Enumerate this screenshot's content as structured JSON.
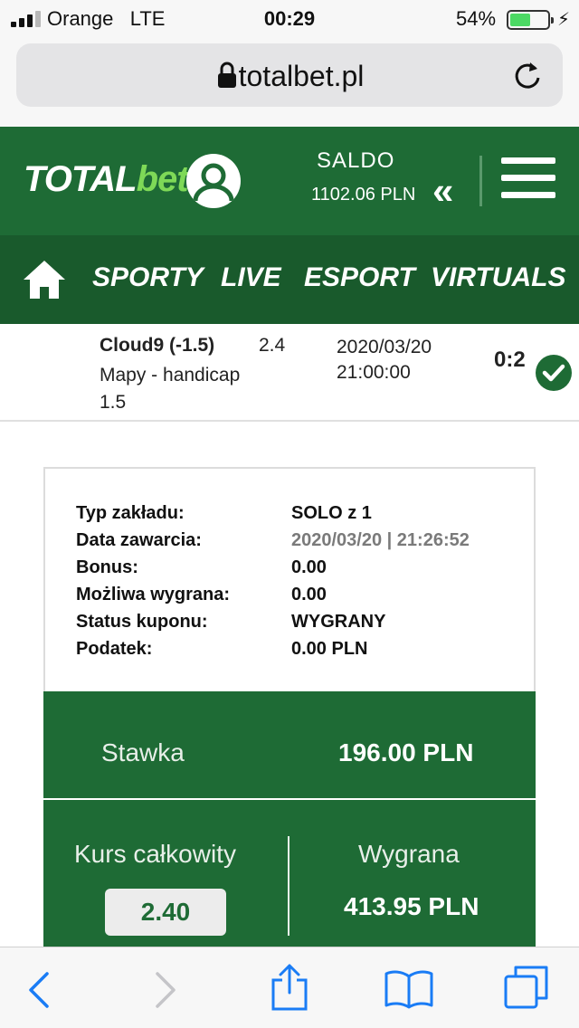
{
  "status_bar": {
    "carrier": "Orange",
    "network": "LTE",
    "time": "00:29",
    "battery_percent": "54%",
    "battery_level": 0.54
  },
  "browser": {
    "url": "totalbet.pl"
  },
  "header": {
    "logo_total": "TOTAL",
    "logo_bet": "bet",
    "saldo_label": "SALDO",
    "saldo_value": "1102.06 PLN"
  },
  "nav": {
    "items": [
      "SPORTY",
      "LIVE",
      "ESPORT",
      "VIRTUALS"
    ]
  },
  "bet": {
    "selection": "Cloud9 (-1.5)",
    "market": "Mapy - handicap 1.5",
    "odd": "2.4",
    "date": "2020/03/20",
    "time": "21:00:00",
    "score": "0:2"
  },
  "summary": {
    "rows": [
      {
        "label": "Typ zakładu:",
        "value": "SOLO z 1"
      },
      {
        "label": "Data zawarcia:",
        "value": "2020/03/20 | 21:26:52"
      },
      {
        "label": "Bonus:",
        "value": "0.00"
      },
      {
        "label": "Możliwa wygrana:",
        "value": "0.00"
      },
      {
        "label": "Status kuponu:",
        "value": "WYGRANY"
      },
      {
        "label": "Podatek:",
        "value": "0.00 PLN"
      }
    ]
  },
  "stake": {
    "label": "Stawka",
    "value": "196.00 PLN"
  },
  "totals": {
    "odds_label": "Kurs całkowity",
    "odds_value": "2.40",
    "win_label": "Wygrana",
    "win_value": "413.95 PLN"
  },
  "colors": {
    "brand_green": "#1e6b35",
    "nav_green": "#195a2c",
    "accent_green": "#7ed957"
  }
}
